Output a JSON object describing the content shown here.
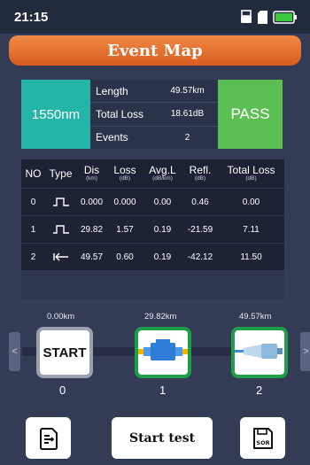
{
  "status_bar": {
    "time": "21:15"
  },
  "header": {
    "title": "Event Map"
  },
  "summary": {
    "wavelength": "1550nm",
    "rows": [
      {
        "label": "Length",
        "value": "49.57km"
      },
      {
        "label": "Total Loss",
        "value": "18.61dB"
      },
      {
        "label": "Events",
        "value": "2"
      }
    ],
    "verdict": "PASS"
  },
  "table": {
    "headers": [
      {
        "label": "NO",
        "unit": ""
      },
      {
        "label": "Type",
        "unit": ""
      },
      {
        "label": "Dis",
        "unit": "(km)"
      },
      {
        "label": "Loss",
        "unit": "(dB)"
      },
      {
        "label": "Avg.L",
        "unit": "(dB/km)"
      },
      {
        "label": "Refl.",
        "unit": "(dB)"
      },
      {
        "label": "Total Loss",
        "unit": "(dB)"
      }
    ],
    "rows": [
      {
        "no": "0",
        "type": "reflective-event-icon",
        "dis": "0.000",
        "loss": "0.000",
        "avg": "0.00",
        "refl": "0.46",
        "total": "0.00"
      },
      {
        "no": "1",
        "type": "reflective-event-icon",
        "dis": "29.82",
        "loss": "1.57",
        "avg": "0.19",
        "refl": "-21.59",
        "total": "7.11"
      },
      {
        "no": "2",
        "type": "fiber-end-icon",
        "dis": "49.57",
        "loss": "0.60",
        "avg": "0.19",
        "refl": "-42.12",
        "total": "11.50"
      }
    ]
  },
  "event_map": {
    "events": [
      {
        "km": "0.00km",
        "index": "0",
        "label": "START"
      },
      {
        "km": "29.82km",
        "index": "1",
        "icon": "connector-icon"
      },
      {
        "km": "49.57km",
        "index": "2",
        "icon": "fiber-end-connector-icon"
      }
    ]
  },
  "bottom": {
    "start_test_label": "Start test",
    "sor_label": "SOR"
  },
  "colors": {
    "accent": "#e8763a",
    "pass": "#5bbf54",
    "wavelength": "#25b5a8",
    "event_border": "#1f9e48"
  }
}
